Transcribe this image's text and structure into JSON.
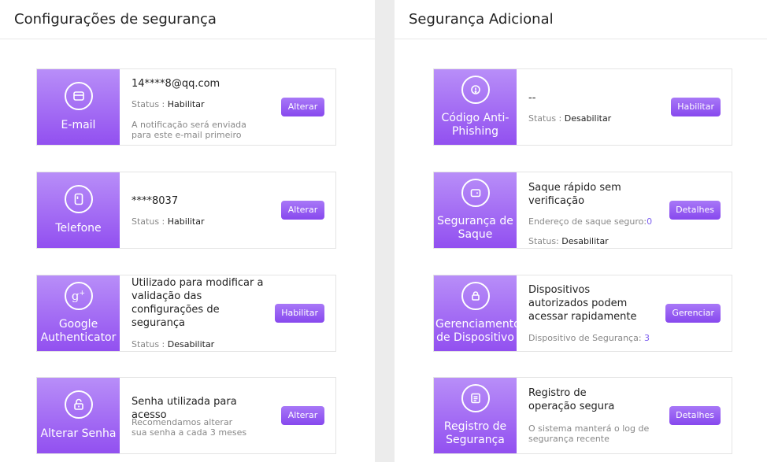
{
  "left_panel": {
    "title": "Configurações de segurança",
    "cards": [
      {
        "icon": "envelope-icon",
        "label": "E-mail",
        "main": "14****8@qq.com",
        "status_label": "Status : ",
        "status_value": "Habilitar",
        "note": "A notificação será enviada para este e-mail primeiro",
        "button": "Alterar"
      },
      {
        "icon": "phone-icon",
        "label": "Telefone",
        "main": "****8037",
        "status_label": "Status : ",
        "status_value": "Habilitar",
        "button": "Alterar"
      },
      {
        "icon": "google-plus-icon",
        "label": "Google Authenticator",
        "main": "Utilizado para modificar a validação das configurações de segurança",
        "status_label": "Status : ",
        "status_value": "Desabilitar",
        "button": "Habilitar"
      },
      {
        "icon": "unlock-icon",
        "label": "Alterar Senha",
        "main": "Senha utilizada para acesso",
        "note": "Recomendamos alterar sua senha a cada 3 meses",
        "button": "Alterar"
      }
    ]
  },
  "right_panel": {
    "title": "Segurança Adicional",
    "cards": [
      {
        "icon": "anti-phishing-icon",
        "label": "Código Anti-Phishing",
        "main": "--",
        "status_label": "Status : ",
        "status_value": "Desabilitar",
        "button": "Habilitar"
      },
      {
        "icon": "wallet-icon",
        "label": "Segurança de Saque",
        "main": "Saque rápido sem verificação",
        "address_label": "Endereço de saque seguro:",
        "address_count": "0",
        "status_label": "Status: ",
        "status_value": "Desabilitar",
        "button": "Detalhes"
      },
      {
        "icon": "device-lock-icon",
        "label": "Gerenciamento de Dispositivo",
        "main": "Dispositivos autorizados podem acessar rapidamente",
        "devices_label": "Dispositivo de Segurança: ",
        "devices_count": "3",
        "button": "Gerenciar"
      },
      {
        "icon": "log-document-icon",
        "label": "Registro de Segurança",
        "main": "Registro de operação segura",
        "note": "O sistema manterá o log de segurança recente",
        "button": "Detalhes"
      }
    ]
  },
  "colors": {
    "accent_top": "#b88ef8",
    "accent_bottom": "#9250f0",
    "button": "#8f55f0",
    "count_text": "#7b5cf0"
  }
}
